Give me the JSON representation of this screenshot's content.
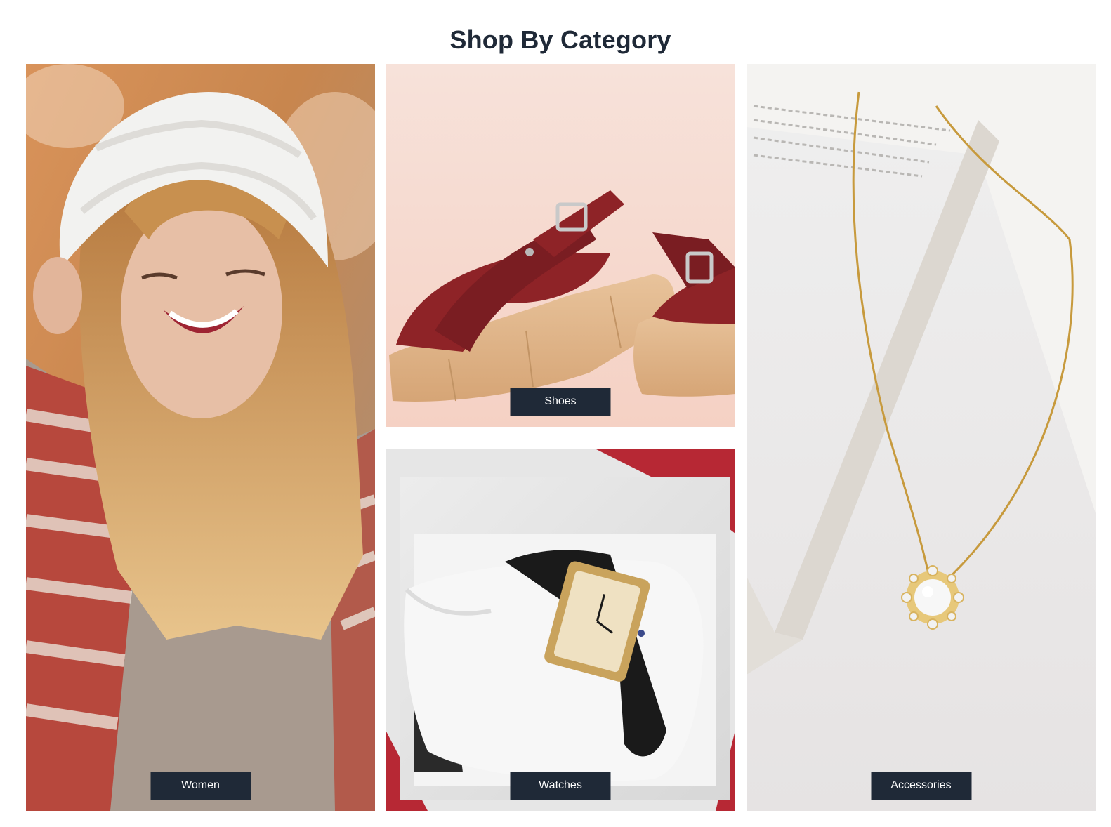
{
  "page": {
    "title": "Shop By Category"
  },
  "categories": [
    {
      "id": "women",
      "label": "Women",
      "image": "smiling-woman-in-knit-hat-photo"
    },
    {
      "id": "shoes",
      "label": "Shoes",
      "image": "red-platform-sandals-photo"
    },
    {
      "id": "watches",
      "label": "Watches",
      "image": "wristwatch-on-pillow-photo"
    },
    {
      "id": "accessories",
      "label": "Accessories",
      "image": "gold-necklace-on-book-photo"
    }
  ],
  "colors": {
    "label_background": "#1f2937",
    "label_text": "#ffffff",
    "title_text": "#1f2937"
  }
}
